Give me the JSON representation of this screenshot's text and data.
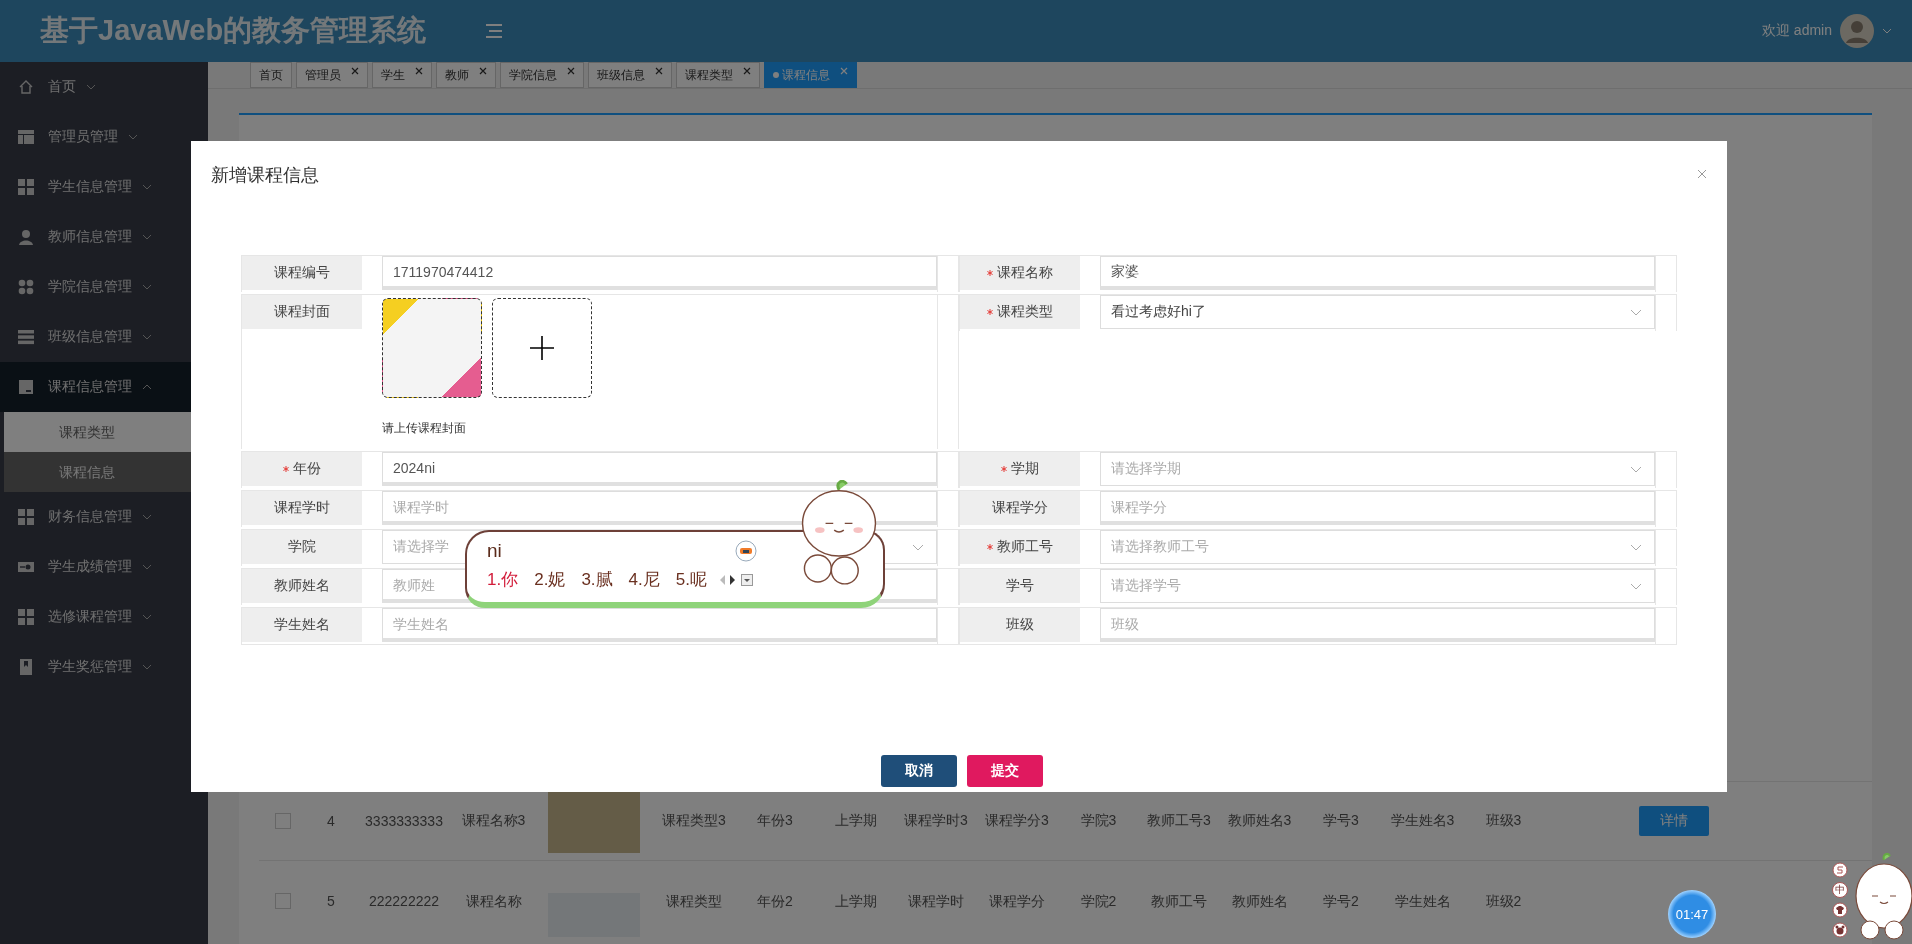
{
  "header": {
    "title": "基于JavaWeb的教务管理系统",
    "welcome": "欢迎 admin"
  },
  "sidebar": {
    "items": [
      {
        "label": "首页",
        "expanded": false
      },
      {
        "label": "管理员管理",
        "expanded": false
      },
      {
        "label": "学生信息管理",
        "expanded": false
      },
      {
        "label": "教师信息管理",
        "expanded": false
      },
      {
        "label": "学院信息管理",
        "expanded": false
      },
      {
        "label": "班级信息管理",
        "expanded": false
      },
      {
        "label": "课程信息管理",
        "expanded": true,
        "children": [
          {
            "label": "课程类型",
            "selected": false
          },
          {
            "label": "课程信息",
            "selected": true
          }
        ]
      },
      {
        "label": "财务信息管理",
        "expanded": false
      },
      {
        "label": "学生成绩管理",
        "expanded": false
      },
      {
        "label": "选修课程管理",
        "expanded": false
      },
      {
        "label": "学生奖惩管理",
        "expanded": false
      }
    ]
  },
  "tabs": [
    {
      "label": "首页",
      "closable": false,
      "selected": false
    },
    {
      "label": "管理员",
      "closable": true,
      "selected": false
    },
    {
      "label": "学生",
      "closable": true,
      "selected": false
    },
    {
      "label": "教师",
      "closable": true,
      "selected": false
    },
    {
      "label": "学院信息",
      "closable": true,
      "selected": false
    },
    {
      "label": "班级信息",
      "closable": true,
      "selected": false
    },
    {
      "label": "课程类型",
      "closable": true,
      "selected": false
    },
    {
      "label": "课程信息",
      "closable": true,
      "selected": true
    }
  ],
  "table": {
    "rows": [
      {
        "checked": false,
        "cells": [
          "4",
          "3333333333",
          "课程名称3"
        ],
        "cells_after": [
          "课程类型3",
          "年份3",
          "上学期",
          "课程学时3",
          "课程学分3",
          "学院3",
          "教师工号3",
          "教师姓名3",
          "学号3",
          "学生姓名3",
          "班级3"
        ],
        "action": "详情"
      },
      {
        "checked": false,
        "cells": [
          "5",
          "222222222",
          "课程名称"
        ],
        "cells_after": [
          "课程类型",
          "年份2",
          "上学期",
          "课程学时",
          "课程学分",
          "学院2",
          "教师工号",
          "教师姓名",
          "学号2",
          "学生姓名",
          "班级2"
        ]
      }
    ]
  },
  "modal": {
    "title": "新增课程信息",
    "form": {
      "left": [
        {
          "label": "课程编号",
          "required": false,
          "kind": "text",
          "value": "1711970474412"
        },
        {
          "label": "课程封面",
          "required": false,
          "kind": "upload",
          "hint": "请上传课程封面"
        },
        {
          "label": "年份",
          "required": true,
          "kind": "text",
          "value": "2024ni"
        },
        {
          "label": "课程学时",
          "required": false,
          "kind": "text",
          "placeholder": "课程学时"
        },
        {
          "label": "学院",
          "required": false,
          "kind": "select",
          "placeholder": "请选择学"
        },
        {
          "label": "教师姓名",
          "required": false,
          "kind": "text",
          "placeholder": "教师姓"
        },
        {
          "label": "学生姓名",
          "required": false,
          "kind": "text",
          "placeholder": "学生姓名"
        }
      ],
      "right": [
        {
          "label": "课程名称",
          "required": true,
          "kind": "text",
          "value": "家婆"
        },
        {
          "label": "课程类型",
          "required": true,
          "kind": "select",
          "value": "看过考虑好hi了"
        },
        {
          "label": "学期",
          "required": true,
          "kind": "select",
          "placeholder": "请选择学期"
        },
        {
          "label": "课程学分",
          "required": false,
          "kind": "text",
          "placeholder": "课程学分"
        },
        {
          "label": "教师工号",
          "required": true,
          "kind": "select",
          "placeholder": "请选择教师工号"
        },
        {
          "label": "学号",
          "required": false,
          "kind": "select",
          "placeholder": "请选择学号"
        },
        {
          "label": "班级",
          "required": false,
          "kind": "text",
          "placeholder": "班级"
        }
      ]
    },
    "buttons": [
      {
        "label": "取消",
        "kind": "cancel"
      },
      {
        "label": "提交",
        "kind": "submit"
      }
    ]
  },
  "ime": {
    "composition": "ni",
    "candidates": [
      {
        "text": "1.你",
        "selected": true
      },
      {
        "text": "2.妮",
        "selected": false
      },
      {
        "text": "3.腻",
        "selected": false
      },
      {
        "text": "4.尼",
        "selected": false
      },
      {
        "text": "5.呢",
        "selected": false
      }
    ],
    "toolbar_mode": "中"
  },
  "timer": "01:47"
}
